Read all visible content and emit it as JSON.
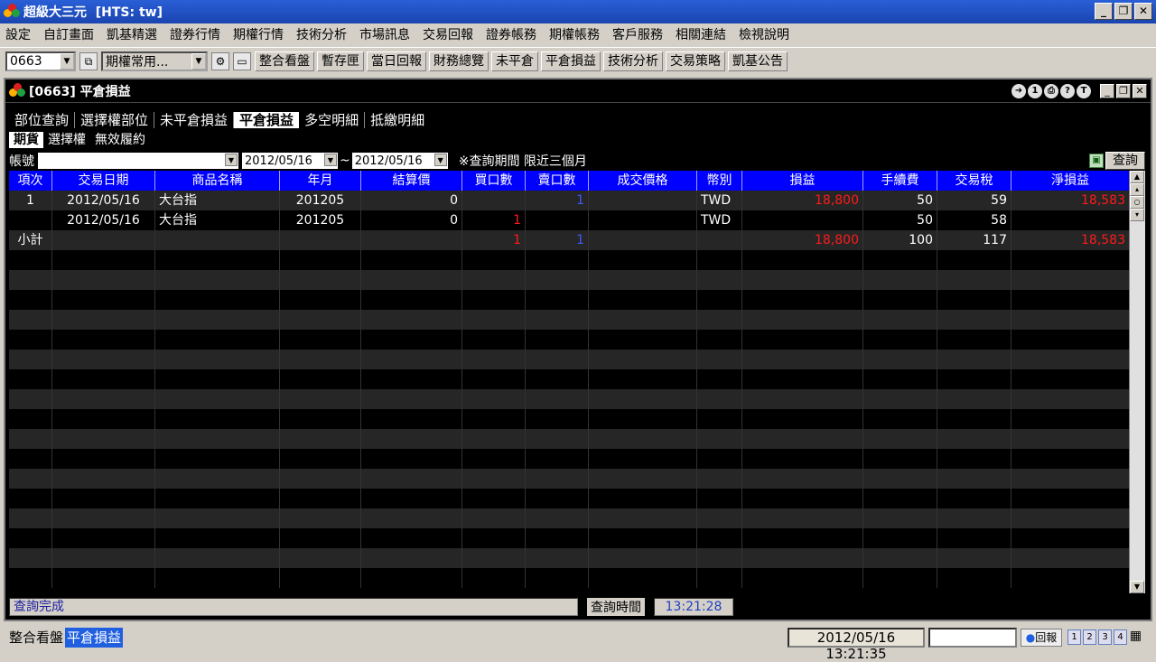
{
  "window": {
    "title": "超級大三元  [HTS: tw]"
  },
  "menu": [
    "設定",
    "自訂畫面",
    "凱基精選",
    "證券行情",
    "期權行情",
    "技術分析",
    "市場訊息",
    "交易回報",
    "證券帳務",
    "期權帳務",
    "客戶服務",
    "相關連結",
    "檢視說明"
  ],
  "toolbar": {
    "code_value": "0663",
    "group_value": "期權常用...",
    "buttons": [
      "整合看盤",
      "暫存匣",
      "當日回報",
      "財務總覽",
      "未平倉",
      "平倉損益",
      "技術分析",
      "交易策略",
      "凱基公告"
    ]
  },
  "inner": {
    "title": "[0663] 平倉損益"
  },
  "tabs": [
    "部位查詢",
    "選擇權部位",
    "未平倉損益",
    "平倉損益",
    "多空明細",
    "抵繳明細"
  ],
  "active_tab": "平倉損益",
  "subtabs": [
    "期貨",
    "選擇權",
    "無效履約"
  ],
  "filter": {
    "account_label": "帳號",
    "account_value": "",
    "date_from": "2012/05/16",
    "tilde": "~",
    "date_to": "2012/05/16",
    "note": "※查詢期間 限近三個月",
    "query_button": "查詢"
  },
  "table": {
    "headers": [
      "項次",
      "交易日期",
      "商品名稱",
      "年月",
      "結算價",
      "買口數",
      "賣口數",
      "成交價格",
      "幣別",
      "損益",
      "手續費",
      "交易稅",
      "淨損益"
    ],
    "rows": [
      {
        "no": "1",
        "date": "2012/05/16",
        "product": "大台指",
        "ym": "201205",
        "settle": "0",
        "buy": "",
        "sell": "1",
        "price": "",
        "currency": "TWD",
        "pnl": "18,800",
        "fee": "50",
        "tax": "59",
        "net": "18,583"
      },
      {
        "no": "",
        "date": "2012/05/16",
        "product": "大台指",
        "ym": "201205",
        "settle": "0",
        "buy": "1",
        "sell": "",
        "price": "",
        "currency": "TWD",
        "pnl": "",
        "fee": "50",
        "tax": "58",
        "net": ""
      },
      {
        "no": "小計",
        "date": "",
        "product": "",
        "ym": "",
        "settle": "",
        "buy": "1",
        "sell": "1",
        "price": "",
        "currency": "",
        "pnl": "18,800",
        "fee": "100",
        "tax": "117",
        "net": "18,583"
      }
    ]
  },
  "status": {
    "message": "查詢完成",
    "time_label": "查詢時間",
    "time_value": "13:21:28"
  },
  "bottom": {
    "tabs": [
      "整合看盤",
      "平倉損益"
    ],
    "active": "平倉損益",
    "datetime": "2012/05/16 13:21:35",
    "report_button": "回報"
  }
}
